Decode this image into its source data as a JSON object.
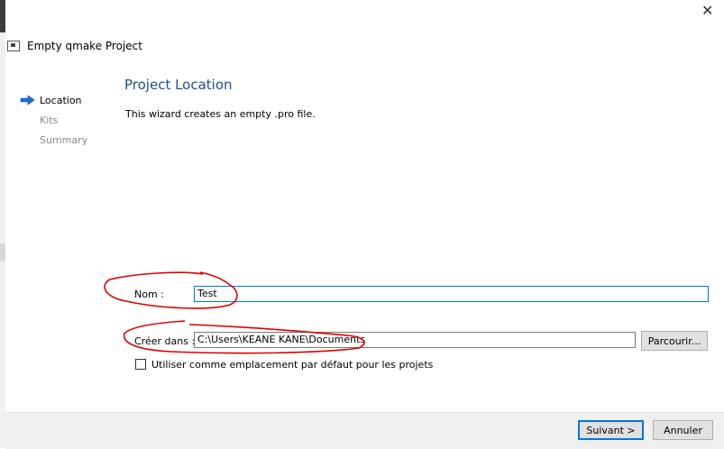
{
  "window": {
    "title": "Empty qmake Project",
    "close_glyph": "✕"
  },
  "steps": [
    {
      "label": "Location",
      "active": true
    },
    {
      "label": "Kits",
      "active": false
    },
    {
      "label": "Summary",
      "active": false
    }
  ],
  "page": {
    "title": "Project Location",
    "subtitle": "This wizard creates an empty .pro file."
  },
  "form": {
    "name_label": "Nom :",
    "name_value": "Test",
    "create_in_label": "Créer dans :",
    "create_in_value": "C:\\Users\\KEANE KANE\\Documents",
    "browse_label": "Parcourir...",
    "default_checkbox_label": "Utiliser comme emplacement par défaut pour les projets",
    "default_checkbox_checked": false
  },
  "buttons": {
    "next_label": "Suivant >",
    "cancel_label": "Annuler"
  },
  "colors": {
    "accent": "#0078d7",
    "title": "#1f4e8c",
    "annotation": "#e00000"
  },
  "icons": {
    "active_step": "arrow-right-icon",
    "window": "qt-window-icon",
    "close": "close-icon"
  }
}
